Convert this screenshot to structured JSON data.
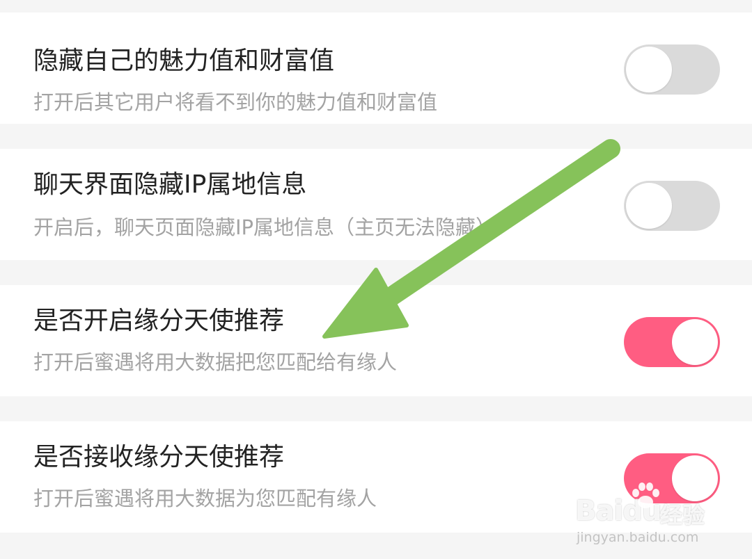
{
  "settings": [
    {
      "title": "隐藏自己的魅力值和财富值",
      "description": "打开后其它用户将看不到你的魅力值和财富值",
      "enabled": false
    },
    {
      "title": "聊天界面隐藏IP属地信息",
      "description": "开启后，聊天页面隐藏IP属地信息（主页无法隐藏）",
      "enabled": false
    },
    {
      "title": "是否开启缘分天使推荐",
      "description": "打开后蜜遇将用大数据把您匹配给有缘人",
      "enabled": true
    },
    {
      "title": "是否接收缘分天使推荐",
      "description": "打开后蜜遇将用大数据为您匹配有缘人",
      "enabled": true
    }
  ],
  "annotation": {
    "arrow_color": "#86c25a",
    "icon": "arrow-annotation-icon"
  },
  "colors": {
    "toggle_on": "#ff5d82",
    "toggle_off": "#dadada",
    "title": "#222222",
    "description": "#a3a3a3",
    "background": "#f5f5f5"
  },
  "watermark": {
    "logo_text": "Baidu",
    "cn_text": "经验",
    "url": "jingyan.baidu.com"
  }
}
